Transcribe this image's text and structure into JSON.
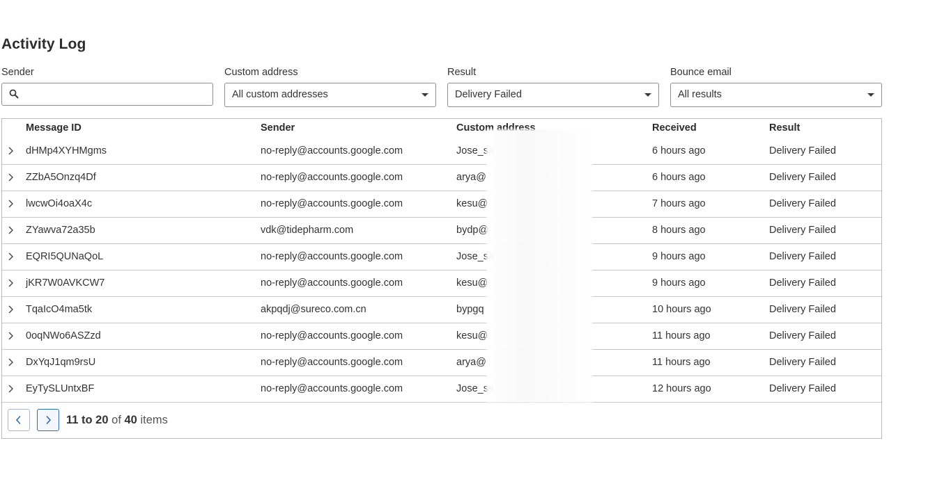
{
  "page": {
    "title": "Activity Log"
  },
  "filters": {
    "sender": {
      "label": "Sender",
      "placeholder": ""
    },
    "custom_address": {
      "label": "Custom address",
      "value": "All custom addresses"
    },
    "result": {
      "label": "Result",
      "value": "Delivery Failed"
    },
    "bounce_email": {
      "label": "Bounce email",
      "value": "All results"
    }
  },
  "table": {
    "columns": [
      "Message ID",
      "Sender",
      "Custom address",
      "Received",
      "Result"
    ],
    "rows": [
      {
        "message_id": "dHMp4XYHMgms",
        "sender": "no-reply@accounts.google.com",
        "custom_address": "Jose_sa",
        "received": "6 hours ago",
        "result": "Delivery Failed"
      },
      {
        "message_id": "ZZbA5Onzq4Df",
        "sender": "no-reply@accounts.google.com",
        "custom_address": "arya@",
        "received": "6 hours ago",
        "result": "Delivery Failed"
      },
      {
        "message_id": "lwcwOi4oaX4c",
        "sender": "no-reply@accounts.google.com",
        "custom_address": "kesu@",
        "received": "7 hours ago",
        "result": "Delivery Failed"
      },
      {
        "message_id": "ZYawva72a35b",
        "sender": "vdk@tidepharm.com",
        "custom_address": "bydp@",
        "received": "8 hours ago",
        "result": "Delivery Failed"
      },
      {
        "message_id": "EQRI5QUNaQoL",
        "sender": "no-reply@accounts.google.com",
        "custom_address": "Jose_sa",
        "received": "9 hours ago",
        "result": "Delivery Failed"
      },
      {
        "message_id": "jKR7W0AVKCW7",
        "sender": "no-reply@accounts.google.com",
        "custom_address": "kesu@",
        "received": "9 hours ago",
        "result": "Delivery Failed"
      },
      {
        "message_id": "TqaIcO4ma5tk",
        "sender": "akpqdj@sureco.com.cn",
        "custom_address": "bypgq",
        "received": "10 hours ago",
        "result": "Delivery Failed"
      },
      {
        "message_id": "0oqNWo6ASZzd",
        "sender": "no-reply@accounts.google.com",
        "custom_address": "kesu@",
        "received": "11 hours ago",
        "result": "Delivery Failed"
      },
      {
        "message_id": "DxYqJ1qm9rsU",
        "sender": "no-reply@accounts.google.com",
        "custom_address": "arya@",
        "received": "11 hours ago",
        "result": "Delivery Failed"
      },
      {
        "message_id": "EyTySLUntxBF",
        "sender": "no-reply@accounts.google.com",
        "custom_address": "Jose_sa",
        "received": "12 hours ago",
        "result": "Delivery Failed"
      }
    ]
  },
  "pagination": {
    "range": "11 to 20",
    "of": "of",
    "total": "40",
    "unit": "items"
  },
  "icons": {
    "search": "search-icon",
    "dropdown": "chevron-down-icon",
    "row_expand": "chevron-right-icon",
    "prev": "chevron-left-icon",
    "next": "chevron-right-icon"
  },
  "colors": {
    "accent": "#2f6bb3",
    "border": "#8e8e8e",
    "text": "#333333"
  }
}
